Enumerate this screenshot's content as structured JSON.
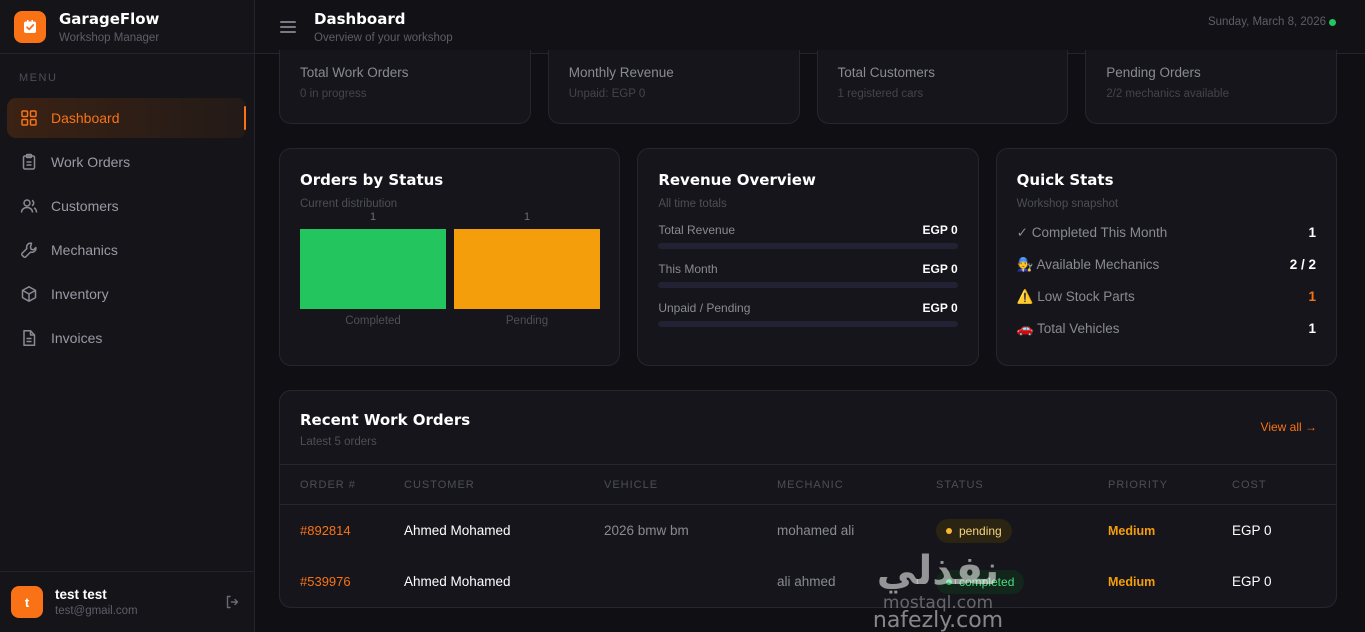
{
  "brand": {
    "title": "GarageFlow",
    "subtitle": "Workshop Manager"
  },
  "sidebar": {
    "menu_label": "MENU",
    "items": [
      {
        "label": "Dashboard",
        "icon": "grid-icon",
        "active": true
      },
      {
        "label": "Work Orders",
        "icon": "clipboard-icon"
      },
      {
        "label": "Customers",
        "icon": "users-icon"
      },
      {
        "label": "Mechanics",
        "icon": "wrench-icon"
      },
      {
        "label": "Inventory",
        "icon": "box-icon"
      },
      {
        "label": "Invoices",
        "icon": "document-icon"
      }
    ],
    "user": {
      "initial": "t",
      "name": "test test",
      "email": "test@gmail.com"
    }
  },
  "header": {
    "title": "Dashboard",
    "subtitle": "Overview of your workshop",
    "date": "Sunday, March 8, 2026"
  },
  "stats": [
    {
      "label": "Total Work Orders",
      "sub": "0 in progress"
    },
    {
      "label": "Monthly Revenue",
      "sub": "Unpaid: EGP 0"
    },
    {
      "label": "Total Customers",
      "sub": "1 registered cars"
    },
    {
      "label": "Pending Orders",
      "sub": "2/2 mechanics available"
    }
  ],
  "orders_by_status": {
    "title": "Orders by Status",
    "subtitle": "Current distribution",
    "chart_data": {
      "type": "bar",
      "categories": [
        "Completed",
        "Pending"
      ],
      "values": [
        1,
        1
      ],
      "colors": [
        "#22c55e",
        "#f59e0b"
      ],
      "ylim": [
        0,
        1
      ]
    }
  },
  "revenue": {
    "title": "Revenue Overview",
    "subtitle": "All time totals",
    "items": [
      {
        "label": "Total Revenue",
        "value": "EGP 0"
      },
      {
        "label": "This Month",
        "value": "EGP 0"
      },
      {
        "label": "Unpaid / Pending",
        "value": "EGP 0"
      }
    ]
  },
  "quick_stats": {
    "title": "Quick Stats",
    "subtitle": "Workshop snapshot",
    "items": [
      {
        "label": "✓ Completed This Month",
        "value": "1",
        "color": "#ffffff"
      },
      {
        "label": "🧑‍🔧 Available Mechanics",
        "value": "2 / 2",
        "color": "#ffffff"
      },
      {
        "label": "⚠️ Low Stock Parts",
        "value": "1",
        "color": "#f97316"
      },
      {
        "label": "🚗 Total Vehicles",
        "value": "1",
        "color": "#ffffff"
      }
    ]
  },
  "recent": {
    "title": "Recent Work Orders",
    "subtitle": "Latest 5 orders",
    "view_all": "View all →",
    "columns": [
      "ORDER #",
      "CUSTOMER",
      "VEHICLE",
      "MECHANIC",
      "STATUS",
      "PRIORITY",
      "COST"
    ],
    "rows": [
      {
        "order": "#892814",
        "customer": "Ahmed Mohamed",
        "vehicle": "2026 bmw bm",
        "mechanic": "mohamed ali",
        "status": "pending",
        "priority": "Medium",
        "cost": "EGP 0"
      },
      {
        "order": "#539976",
        "customer": "Ahmed Mohamed",
        "vehicle": "",
        "mechanic": "ali ahmed",
        "status": "completed",
        "priority": "Medium",
        "cost": "EGP 0"
      }
    ]
  },
  "watermark": {
    "arabic": "نفذلي",
    "latin1": "mostaql.com",
    "latin2": "nafezly.com"
  },
  "colors": {
    "accent": "#f97316",
    "success": "#22c55e",
    "warning": "#f59e0b",
    "bg": "#0f0f14",
    "card": "#15151b"
  }
}
